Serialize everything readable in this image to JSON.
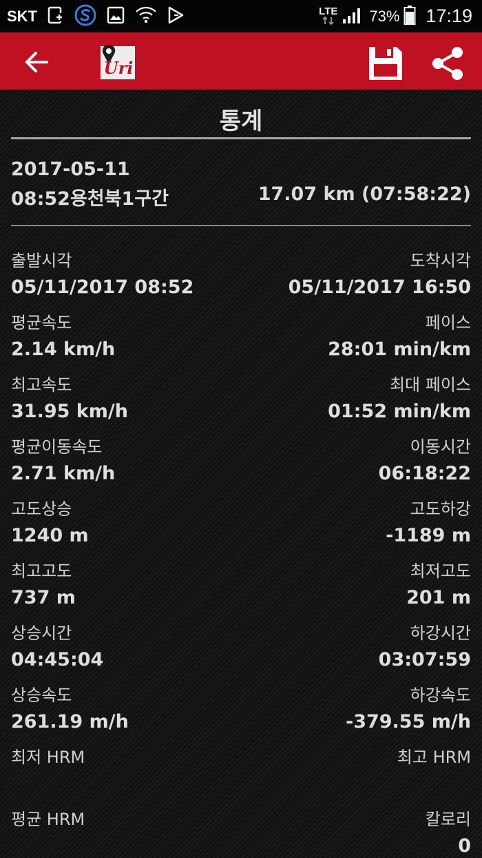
{
  "status_bar": {
    "carrier": "SKT",
    "network": "LTE",
    "battery": "73%",
    "time": "17:19",
    "icons": [
      "sim-card-icon",
      "samsung-app-icon",
      "gallery-icon",
      "wifi-new-icon",
      "play-store-icon",
      "data-arrows-icon",
      "signal-icon",
      "battery-icon"
    ]
  },
  "appbar": {
    "logo_text": "Uri",
    "back_icon": "arrow-left-icon",
    "save_icon": "floppy-disk-icon",
    "share_icon": "share-icon",
    "accent": "#bf1122"
  },
  "page": {
    "title": "통계"
  },
  "summary": {
    "date": "2017-05-11",
    "name": "08:52용천북1구간",
    "total": "17.07 km (07:58:22)"
  },
  "stats": [
    {
      "left_label": "출발시각",
      "left_value": "05/11/2017 08:52",
      "right_label": "도착시각",
      "right_value": "05/11/2017 16:50"
    },
    {
      "left_label": "평균속도",
      "left_value": "2.14 km/h",
      "right_label": "페이스",
      "right_value": "28:01 min/km"
    },
    {
      "left_label": "최고속도",
      "left_value": "31.95 km/h",
      "right_label": "최대 페이스",
      "right_value": "01:52 min/km"
    },
    {
      "left_label": "평균이동속도",
      "left_value": "2.71 km/h",
      "right_label": "이동시간",
      "right_value": "06:18:22"
    },
    {
      "left_label": "고도상승",
      "left_value": "1240 m",
      "right_label": "고도하강",
      "right_value": "-1189 m"
    },
    {
      "left_label": "최고고도",
      "left_value": "737 m",
      "right_label": "최저고도",
      "right_value": "201 m"
    },
    {
      "left_label": "상승시간",
      "left_value": "04:45:04",
      "right_label": "하강시간",
      "right_value": "03:07:59"
    },
    {
      "left_label": "상승속도",
      "left_value": "261.19 m/h",
      "right_label": "하강속도",
      "right_value": "-379.55 m/h"
    },
    {
      "left_label": "최저 HRM",
      "left_value": "",
      "right_label": "최고 HRM",
      "right_value": ""
    },
    {
      "left_label": "평균 HRM",
      "left_value": "",
      "right_label": "칼로리",
      "right_value": "0"
    }
  ]
}
